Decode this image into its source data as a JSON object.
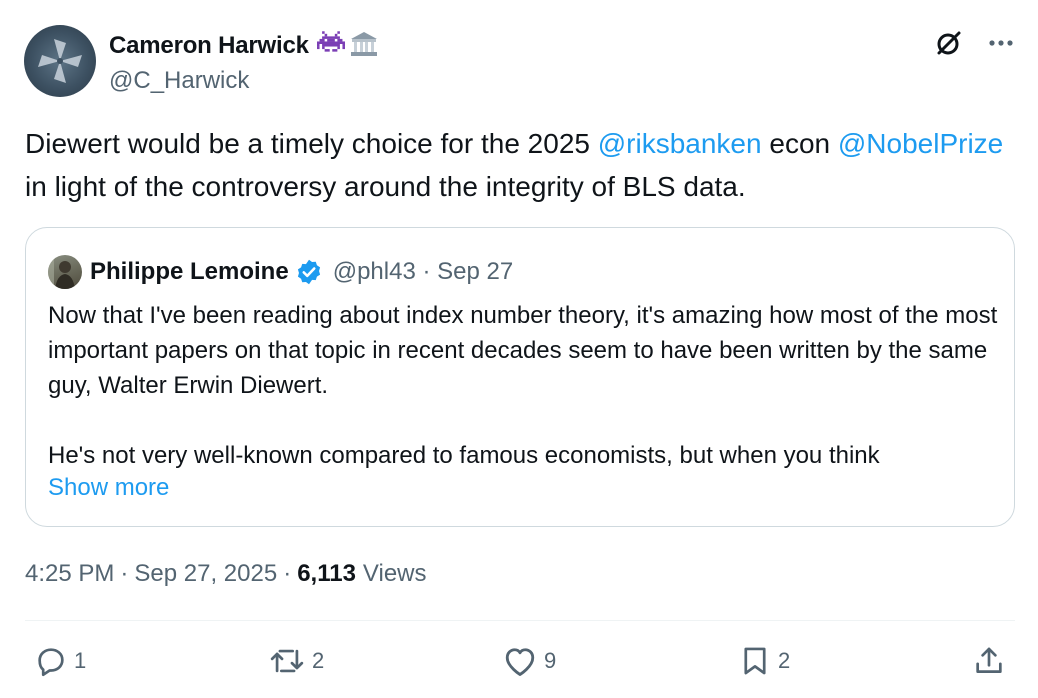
{
  "author": {
    "display_name": "Cameron Harwick",
    "emoji": [
      "alien-monster",
      "classical-building"
    ],
    "handle": "@C_Harwick"
  },
  "top_icons": [
    "grok-icon",
    "more-icon"
  ],
  "tweet": {
    "parts": [
      {
        "text": "Diewert would be a timely choice for the 2025 ",
        "link": false
      },
      {
        "text": "@riksbanken",
        "link": true
      },
      {
        "text": " econ ",
        "link": false
      },
      {
        "text": "@NobelPrize",
        "link": true
      },
      {
        "text": " in light of the controversy around the integrity of BLS data.",
        "link": false
      }
    ]
  },
  "quote": {
    "display_name": "Philippe Lemoine",
    "verified": true,
    "handle_date": "@phl43 · Sep 27",
    "paragraph1": "Now that I've been reading about index number theory, it's amazing how most of the most important papers on that topic in recent decades seem to have been written by the same guy, Walter Erwin Diewert.",
    "paragraph2": "He's not very well-known compared to famous economists, but when you think",
    "show_more": "Show more"
  },
  "meta": {
    "time": "4:25 PM",
    "date": "Sep 27, 2025",
    "views_count": "6,113",
    "views_label": "Views"
  },
  "actions": {
    "replies": "1",
    "reposts": "2",
    "likes": "9",
    "bookmarks": "2"
  },
  "colors": {
    "link": "#1d9bf0",
    "secondary_text": "#536471",
    "primary_text": "#0f1419",
    "border": "#cfd9de",
    "verified": "#1d9bf0"
  }
}
